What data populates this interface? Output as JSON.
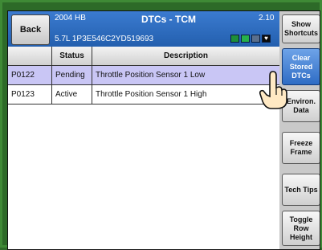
{
  "header": {
    "back_label": "Back",
    "vehicle_line1": "2004 HB",
    "vehicle_line2": "5.7L  1P3E546C2YD519693",
    "title": "DTCs - TCM",
    "version": "2.10"
  },
  "right_buttons": {
    "show_shortcuts": "Show Shortcuts",
    "clear_dtcs": "Clear Stored DTCs",
    "environ_data": "Environ. Data",
    "freeze_frame": "Freeze Frame",
    "tech_tips": "Tech Tips",
    "toggle_row_height": "Toggle Row Height"
  },
  "table": {
    "columns": [
      "",
      "Status",
      "Description"
    ],
    "rows": [
      {
        "code": "P0122",
        "status": "Pending",
        "description": "Throttle Position Sensor 1 Low",
        "selected": true
      },
      {
        "code": "P0123",
        "status": "Active",
        "description": "Throttle Position Sensor 1 High",
        "selected": false
      }
    ]
  },
  "icons": {
    "status": [
      "battery-icon",
      "signal-icon",
      "cable-icon",
      "heart-icon"
    ],
    "pointer": "hand-pointer-icon"
  },
  "colors": {
    "header_blue": "#2a67b8",
    "selected_row": "#c9c6f5",
    "frame_green": "#2d6a28",
    "button_blue": "#2e6cc4"
  }
}
